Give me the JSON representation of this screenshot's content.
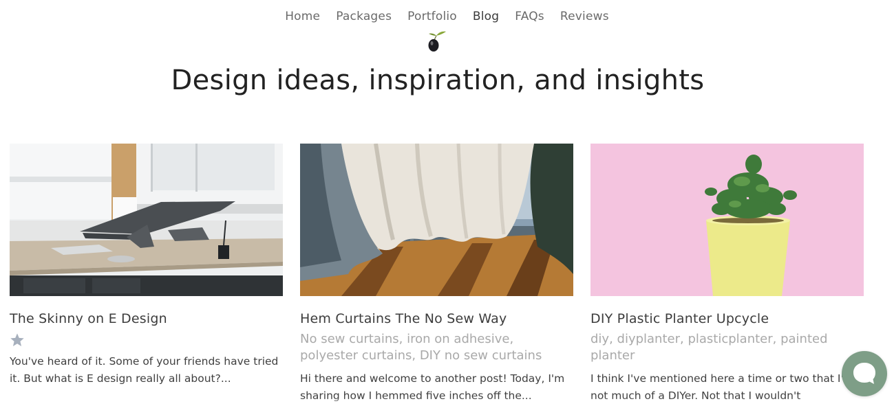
{
  "nav": {
    "items": [
      {
        "label": "Home"
      },
      {
        "label": "Packages"
      },
      {
        "label": "Portfolio"
      },
      {
        "label": "Blog"
      },
      {
        "label": "FAQs"
      },
      {
        "label": "Reviews"
      }
    ],
    "active": "Blog"
  },
  "page": {
    "title": "Design ideas, inspiration, and insights"
  },
  "posts": [
    {
      "title": "The Skinny on E Design",
      "tags": "",
      "excerpt": "You've heard of it. Some of your friends have tried it. But what is E design really all about?..."
    },
    {
      "title": "Hem Curtains The No Sew Way",
      "tags": "No sew curtains, iron on adhesive, polyester curtains, DIY no sew curtains",
      "excerpt": "Hi there and welcome to another post! Today, I'm sharing how I hemmed five inches off the..."
    },
    {
      "title": "DIY Plastic Planter Upcycle",
      "tags": "diy, diyplanter, plasticplanter, painted planter",
      "excerpt": "I think I've mentioned here a time or two that I'm not much of a DIYer. Not that I wouldn't"
    }
  ],
  "icons": {
    "logo": "olive-logo-icon",
    "star": "star-icon",
    "chat": "chat-bubble-icon"
  },
  "colors": {
    "accent": "#7e9e87",
    "tag_gray": "#a9a9a9",
    "planter_background": "#f4c4df"
  }
}
